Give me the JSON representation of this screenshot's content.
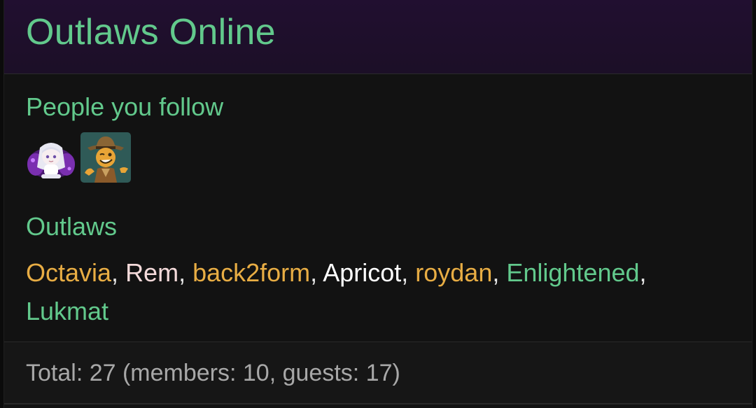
{
  "widget": {
    "title": "Outlaws Online"
  },
  "following": {
    "title": "People you follow",
    "avatars": [
      {
        "icon": "anime-girl-avatar-icon"
      },
      {
        "icon": "cowboy-mascot-avatar-icon"
      }
    ]
  },
  "outlaws": {
    "title": "Outlaws",
    "members": [
      {
        "name": "Octavia",
        "color": "#e8ad44"
      },
      {
        "name": "Rem",
        "color": "#f4dada"
      },
      {
        "name": "back2form",
        "color": "#e8ad44"
      },
      {
        "name": "Apricot",
        "color": "#ffffff"
      },
      {
        "name": "roydan",
        "color": "#e8ad44"
      },
      {
        "name": "Enlightened",
        "color": "#62c98c"
      },
      {
        "name": "Lukmat",
        "color": "#62c98c"
      }
    ],
    "separator": ", "
  },
  "footer": {
    "total_text": "Total: 27 (members: 10, guests: 17)"
  },
  "colors": {
    "accent_green": "#62c98c",
    "header_bg": "#210f30",
    "body_bg": "#121212",
    "muted_text": "#a8a8a8"
  }
}
